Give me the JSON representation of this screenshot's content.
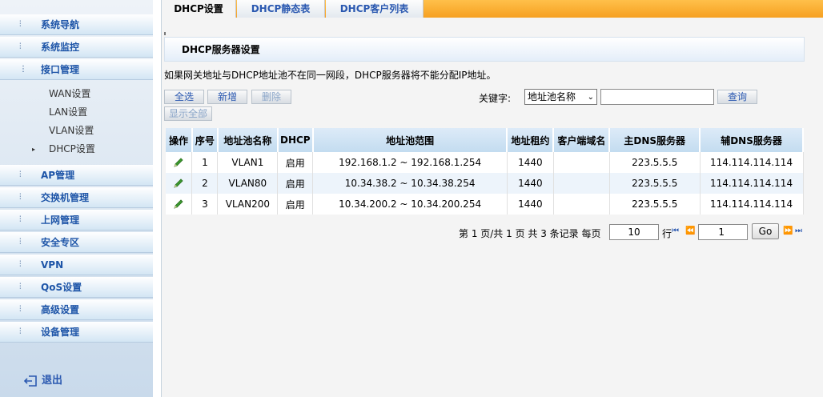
{
  "sidebar": {
    "items_top": [
      {
        "label": "系统导航",
        "arrow": "⫶"
      },
      {
        "label": "系统监控",
        "arrow": "⫶"
      },
      {
        "label": "接口管理",
        "arrow": "⋮"
      }
    ],
    "sub_items": [
      {
        "label": "WAN设置"
      },
      {
        "label": "LAN设置"
      },
      {
        "label": "VLAN设置"
      },
      {
        "label": "DHCP设置",
        "marker": "▸"
      }
    ],
    "items_bottom": [
      {
        "label": "AP管理",
        "arrow": "⫶"
      },
      {
        "label": "交换机管理",
        "arrow": "⫶"
      },
      {
        "label": "上网管理",
        "arrow": "⫶"
      },
      {
        "label": "安全专区",
        "arrow": "⫶"
      },
      {
        "label": "VPN",
        "arrow": "⫶"
      },
      {
        "label": "QoS设置",
        "arrow": "⫶"
      },
      {
        "label": "高级设置",
        "arrow": "⫶"
      },
      {
        "label": "设备管理",
        "arrow": "⫶"
      }
    ],
    "logout_label": "退出",
    "logout_icon": "logout-icon"
  },
  "tabs": [
    {
      "label": "DHCP设置",
      "active": true
    },
    {
      "label": "DHCP静态表",
      "active": false
    },
    {
      "label": "DHCP客户列表",
      "active": false
    }
  ],
  "section_title": "DHCP服务器设置",
  "notice": "如果网关地址与DHCP地址池不在同一网段，DHCP服务器将不能分配IP地址。",
  "toolbar": {
    "select_all": "全选",
    "add": "新增",
    "delete": "删除",
    "show_all": "显示全部",
    "keyword_label": "关键字:",
    "keyword_select": "地址池名称",
    "keyword_value": "",
    "search": "查询"
  },
  "table": {
    "headers": [
      "操作",
      "序号",
      "地址池名称",
      "DHCP",
      "地址池范围",
      "地址租约",
      "客户端域名",
      "主DNS服务器",
      "辅DNS服务器"
    ],
    "rows": [
      {
        "no": "1",
        "name": "VLAN1",
        "dhcp": "启用",
        "range": "192.168.1.2 ~ 192.168.1.254",
        "lease": "1440",
        "domain": "",
        "dns1": "223.5.5.5",
        "dns2": "114.114.114.114"
      },
      {
        "no": "2",
        "name": "VLAN80",
        "dhcp": "启用",
        "range": "10.34.38.2 ~ 10.34.38.254",
        "lease": "1440",
        "domain": "",
        "dns1": "223.5.5.5",
        "dns2": "114.114.114.114"
      },
      {
        "no": "3",
        "name": "VLAN200",
        "dhcp": "启用",
        "range": "10.34.200.2 ~ 10.34.200.254",
        "lease": "1440",
        "domain": "",
        "dns1": "223.5.5.5",
        "dns2": "114.114.114.114"
      }
    ]
  },
  "pager": {
    "summary": "第 1 页/共 1 页 共 3 条记录 每页",
    "per_page": "10",
    "rows_unit": "行",
    "page_input": "1",
    "go": "Go"
  },
  "colors": {
    "link_blue": "#2a58b0",
    "tab_orange": "#f6a021",
    "edit_green": "#3c9a2f"
  }
}
